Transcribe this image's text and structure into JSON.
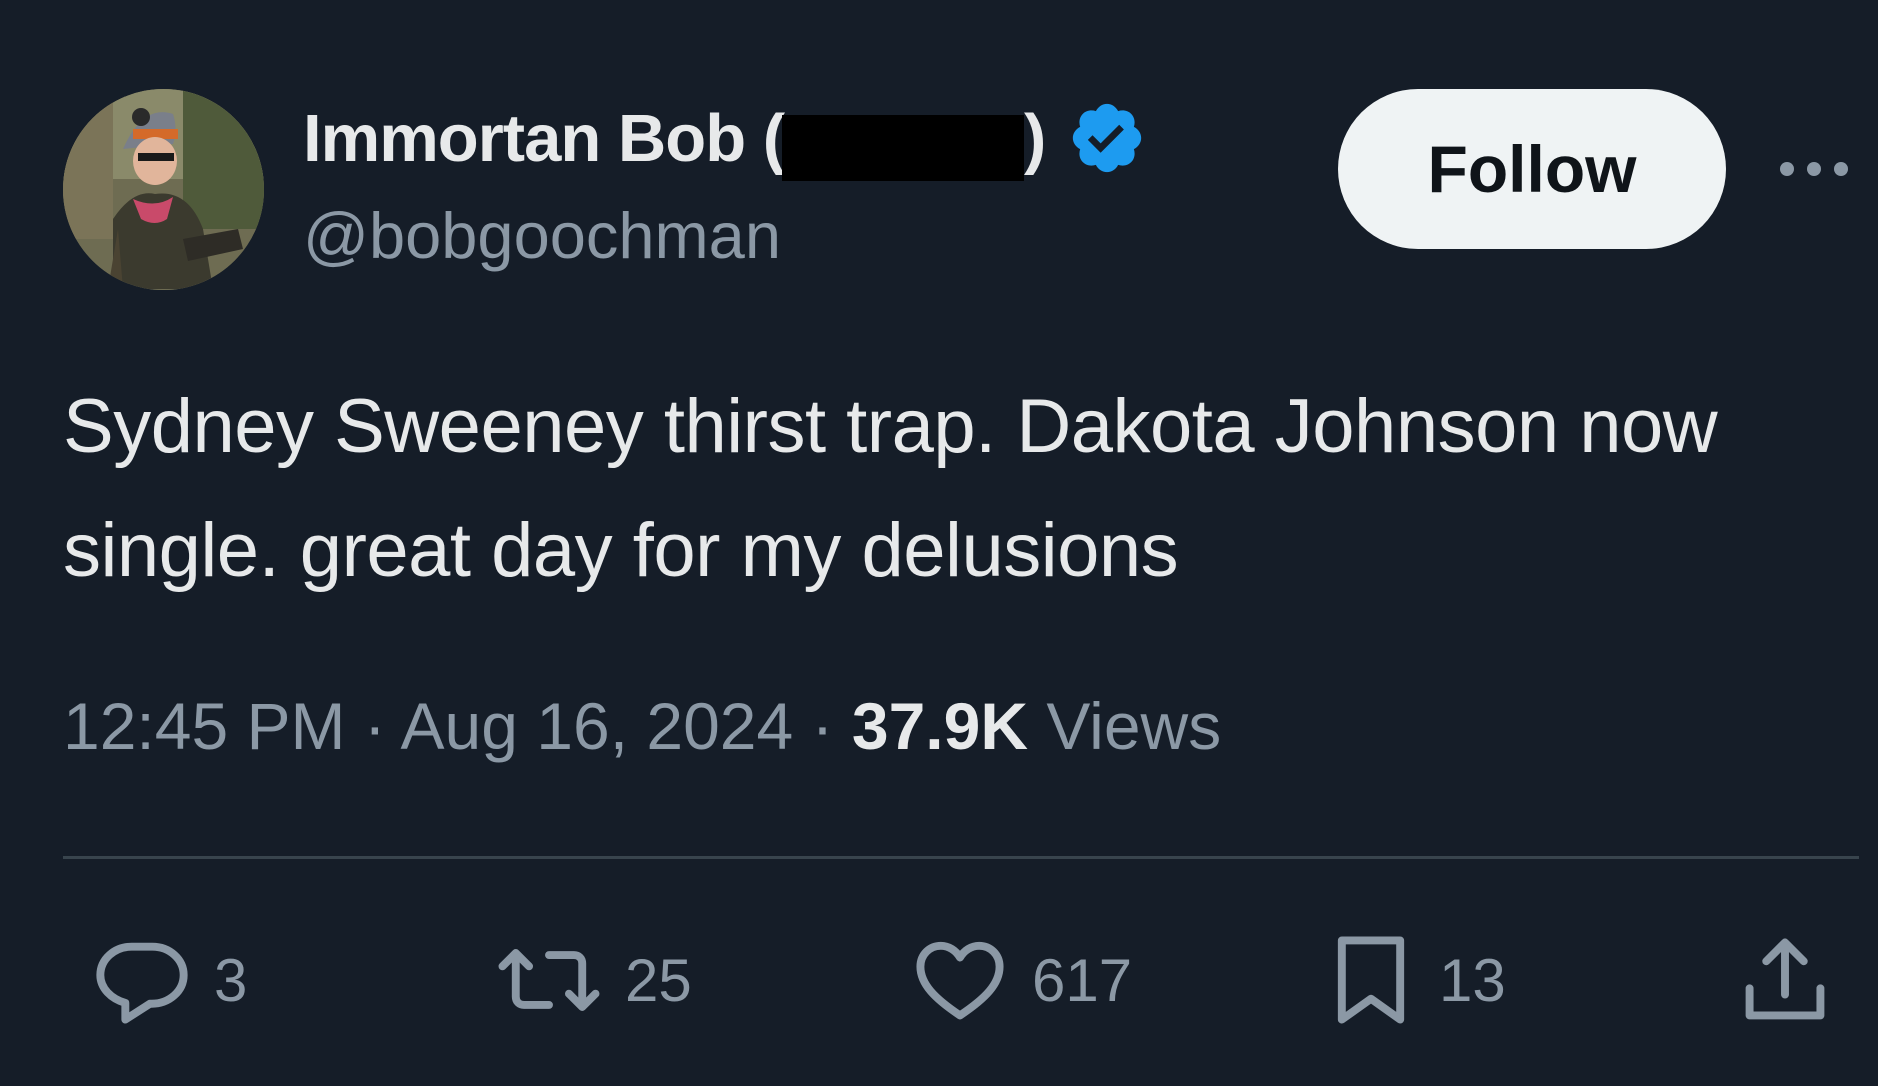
{
  "author": {
    "display_name": "Immortan Bob (",
    "display_name_end": ")",
    "handle": "@bobgoochman",
    "verified": true,
    "verified_color": "#1d9bf0"
  },
  "follow_button": {
    "label": "Follow"
  },
  "more_icon": "more-horizontal-icon",
  "tweet": {
    "text": "Sydney Sweeney thirst trap. Dakota Johnson now single. great day for my delusions"
  },
  "meta": {
    "time": "12:45 PM",
    "separator": " · ",
    "date": "Aug 16, 2024",
    "views_count": "37.9K",
    "views_label": "Views"
  },
  "actions": {
    "replies": "3",
    "retweets": "25",
    "likes": "617",
    "bookmarks": "13"
  },
  "colors": {
    "background": "#151d28",
    "primary_text": "#e7e9ea",
    "secondary_text": "#8b98a5",
    "divider": "#38444d",
    "follow_bg": "#eff3f4"
  }
}
